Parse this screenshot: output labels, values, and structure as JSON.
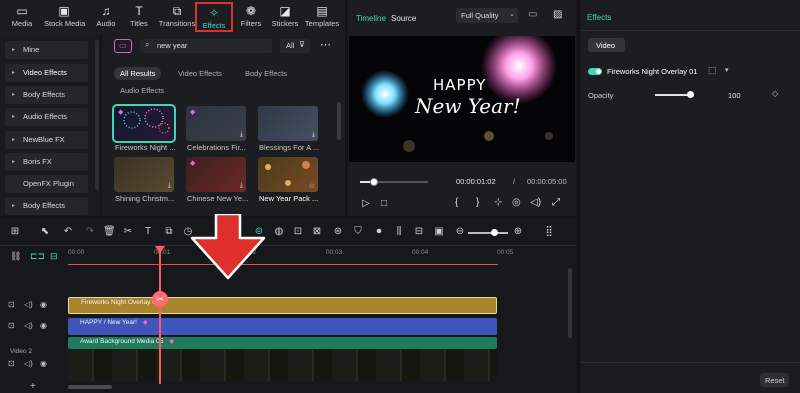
{
  "toolbar": {
    "items": [
      {
        "label": "Media",
        "icon": "folder-icon"
      },
      {
        "label": "Stock Media",
        "icon": "stock-media-icon"
      },
      {
        "label": "Audio",
        "icon": "music-note-icon"
      },
      {
        "label": "Titles",
        "icon": "titles-icon"
      },
      {
        "label": "Transitions",
        "icon": "transitions-icon"
      },
      {
        "label": "Effects",
        "icon": "effects-sparkle-icon",
        "active": true
      },
      {
        "label": "Filters",
        "icon": "filters-icon"
      },
      {
        "label": "Stickers",
        "icon": "stickers-icon"
      },
      {
        "label": "Templates",
        "icon": "templates-icon"
      }
    ]
  },
  "sidebar": {
    "items": [
      {
        "label": "Mine",
        "arrow": false
      },
      {
        "label": "Video Effects",
        "arrow": true,
        "selected": true
      },
      {
        "label": "Body Effects",
        "arrow": true
      },
      {
        "label": "Audio Effects",
        "arrow": true
      },
      {
        "label": "NewBlue FX",
        "arrow": true
      },
      {
        "label": "Boris FX",
        "arrow": true
      },
      {
        "label": "OpenFX Plugin",
        "arrow": false
      },
      {
        "label": "Body Effects",
        "arrow": true
      }
    ]
  },
  "browser": {
    "search_value": "new year",
    "filter_label": "All",
    "chips": [
      "All Results",
      "Video Effects",
      "Body Effects",
      "Audio Effects"
    ],
    "results": [
      {
        "caption": "Fireworks Night ..."
      },
      {
        "caption": "Celebrations Fir..."
      },
      {
        "caption": "Blessings For A ..."
      },
      {
        "caption": "Shining Christm..."
      },
      {
        "caption": "Chinese New Ye..."
      },
      {
        "caption": "New Year Pack ..."
      }
    ]
  },
  "preview": {
    "tabs": [
      "Timeline",
      "Source"
    ],
    "quality": "Full Quality",
    "overlay_text_1": "HAPPY",
    "overlay_text_2": "New Year!",
    "current_time": "00:00:01:02",
    "separator": "/",
    "total_time": "00:00:05:00",
    "progress": 0.2
  },
  "panel": {
    "title": "Effects",
    "tab": "Video",
    "effect_name": "Fireworks Night Overlay 01",
    "opacity_label": "Opacity",
    "opacity_value": "100",
    "reset_label": "Reset"
  },
  "timeline": {
    "ruler": [
      "00:00",
      "00:01",
      "00:02",
      "00:03",
      "00:04",
      "00:05"
    ],
    "track_label": "Video 2",
    "clips": {
      "effect": "Fireworks Night Overlay 0",
      "title": "HAPPY / New Year!",
      "video": "Award Background Media 05"
    },
    "playhead_seconds": 1.02
  },
  "colors": {
    "accent": "#3fd6b6",
    "highlight": "#e0302c",
    "effect_clip": "#b08a2e",
    "title_clip": "#3f55b9",
    "video_clip": "#1f7a5e",
    "playhead": "#ff5a5f"
  }
}
